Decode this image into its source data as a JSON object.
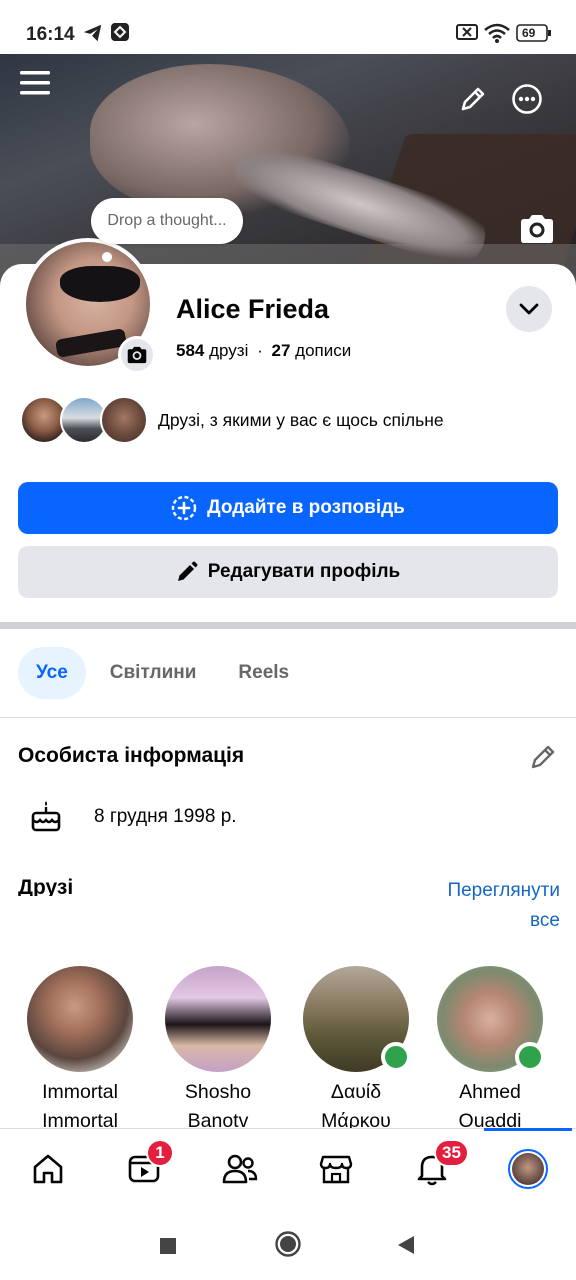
{
  "status_bar": {
    "time": "16:14",
    "battery": "69",
    "icons": [
      "telegram-icon",
      "app-icon",
      "sim-off-icon",
      "wifi-icon",
      "battery-icon"
    ]
  },
  "cover": {
    "menu_icon": "menu-icon",
    "edit_icon": "pencil-icon",
    "more_icon": "more-icon",
    "camera_icon": "camera-icon"
  },
  "profile": {
    "thought_placeholder": "Drop a thought...",
    "name": "Alice Frieda",
    "friends_count": "584",
    "friends_label": "друзі",
    "separator": "·",
    "posts_count": "27",
    "posts_label": "дописи",
    "mutual_text": "Друзі, з якими у вас є щось спільне"
  },
  "actions": {
    "add_story": "Додайте в розповідь",
    "edit_profile": "Редагувати профіль"
  },
  "tabs": [
    {
      "label": "Усе",
      "active": true
    },
    {
      "label": "Світлини",
      "active": false
    },
    {
      "label": "Reels",
      "active": false
    }
  ],
  "personal_info": {
    "title": "Особиста інформація",
    "birthday": "8 грудня 1998 р."
  },
  "friends": {
    "title": "Друзі",
    "see_all": "Переглянути все",
    "items": [
      {
        "name": "Immortal Immortal",
        "online": false
      },
      {
        "name": "Shosho Banotv",
        "online": false
      },
      {
        "name": "Δαυίδ Μάρκου",
        "online": true
      },
      {
        "name": "Ahmed Ouaddi",
        "online": true
      }
    ]
  },
  "bottom_nav": {
    "items": [
      "home-icon",
      "video-icon",
      "friends-icon",
      "marketplace-icon",
      "notifications-icon",
      "profile-avatar"
    ],
    "video_badge": "1",
    "notifications_badge": "35"
  },
  "colors": {
    "accent": "#0866ff",
    "badge": "#e41e3f",
    "online": "#31a24c",
    "link": "#1467c8"
  }
}
